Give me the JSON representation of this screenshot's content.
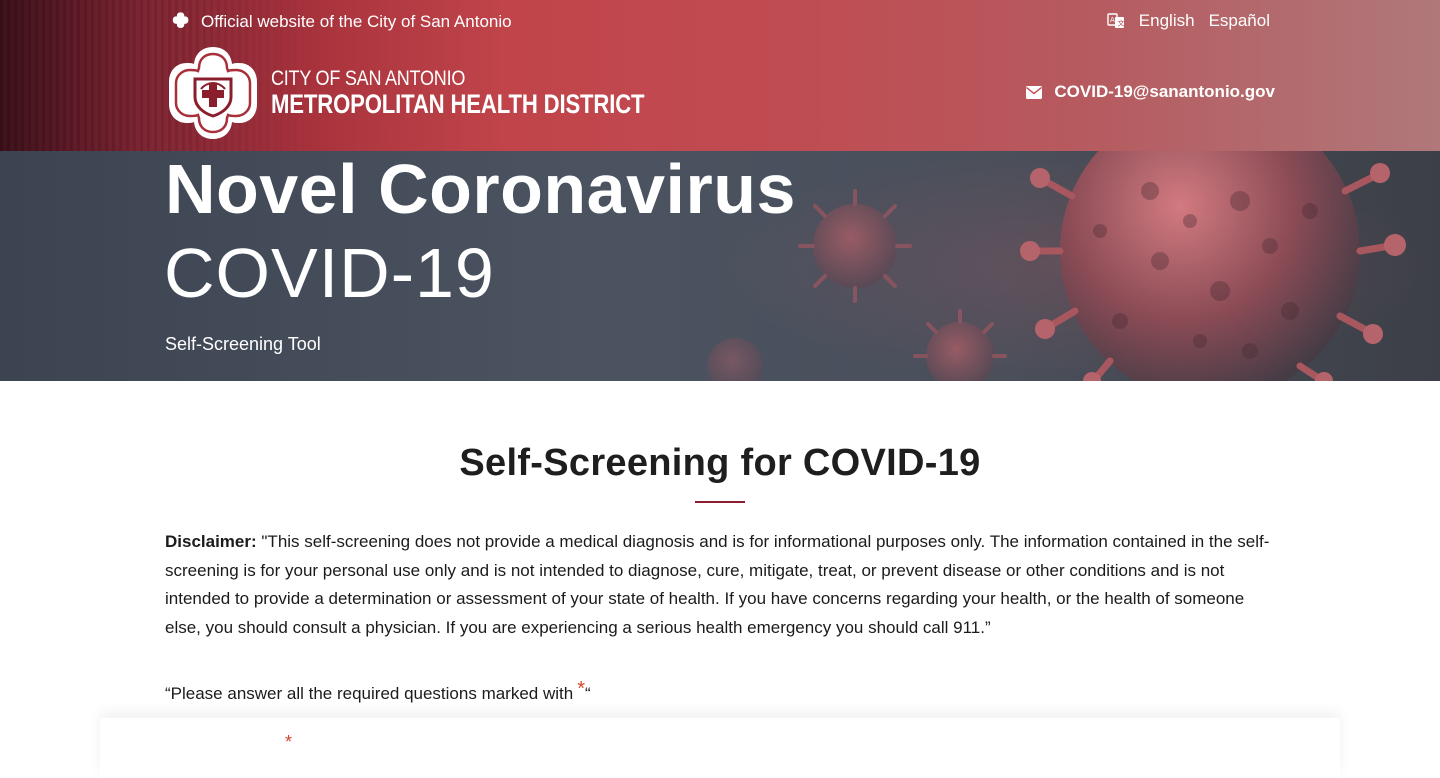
{
  "header": {
    "official_text": "Official website of the City of San Antonio",
    "languages": [
      "English",
      "Español"
    ],
    "logo_line1": "CITY OF SAN ANTONIO",
    "logo_line2": "METROPOLITAN HEALTH DISTRICT",
    "email": "COVID-19@sanantonio.gov",
    "icons": {
      "official": "city-flower-icon",
      "language": "translate-icon",
      "email": "envelope-icon"
    }
  },
  "hero": {
    "title": "Novel Coronavirus",
    "subtitle": "COVID-19",
    "tool_label": "Self-Screening Tool"
  },
  "main": {
    "heading": "Self-Screening for COVID-19",
    "disclaimer_label": "Disclaimer:",
    "disclaimer_text": " \"This self-screening does not provide a medical diagnosis and is for informational purposes only. The information contained in the self-screening is for your personal use only and is not intended to diagnose, cure, mitigate, treat, or prevent disease or other conditions and is not intended to provide a determination or assessment of your state of health. If you have concerns regarding your health, or the health of someone else, you should consult a physician. If you are experiencing a serious health emergency you should call 911.”",
    "required_note_text": "“Please answer all the required questions marked with",
    "required_star": "*",
    "required_note_close": "“"
  },
  "colors": {
    "brand_red": "#c0444a",
    "accent_divider": "#8b1e2c",
    "required_star": "#d2452c"
  }
}
